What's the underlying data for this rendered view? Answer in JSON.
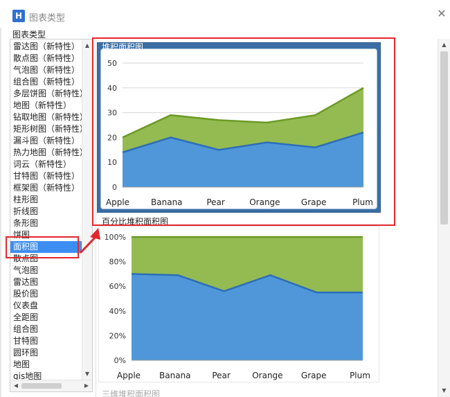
{
  "window": {
    "icon_letter": "H",
    "title": "图表类型",
    "close": "✕"
  },
  "section_label": "图表类型",
  "chart_types": [
    "雷达图（新特性）",
    "散点图（新特性）",
    "气泡图（新特性）",
    "组合图（新特性）",
    "多层饼图（新特性）",
    "地图（新特性）",
    "钻取地图（新特性）",
    "矩形树图（新特性）",
    "漏斗图（新特性）",
    "热力地图（新特性）",
    "词云（新特性）",
    "甘特图（新特性）",
    "框架图（新特性）",
    "柱形图",
    "折线图",
    "条形图",
    "饼图",
    "面积图",
    "散点图",
    "气泡图",
    "雷达图",
    "股价图",
    "仪表盘",
    "全距图",
    "组合图",
    "甘特图",
    "圆环图",
    "地图",
    "gis地图"
  ],
  "selected_index": 17,
  "previews": {
    "stacked_title": "堆积面积图",
    "percent_title": "百分比堆积面积图",
    "third_title": "三维堆积面积图"
  },
  "colors": {
    "blue_fill": "#4f97d9",
    "blue_line": "#2d6db8",
    "green_fill": "#93bb52",
    "green_line": "#6b9a24",
    "annotation": "#e3262b"
  },
  "chart_data": [
    {
      "type": "area",
      "stacked": true,
      "title": "堆积面积图",
      "categories": [
        "Apple",
        "Banana",
        "Pear",
        "Orange",
        "Grape",
        "Plum"
      ],
      "series": [
        {
          "values": [
            14,
            20,
            15,
            18,
            16,
            22
          ]
        },
        {
          "values": [
            6,
            9,
            12,
            8,
            13,
            18
          ]
        }
      ],
      "ylim": [
        0,
        50
      ],
      "yticks": [
        "0",
        "10",
        "20",
        "30",
        "40",
        "50"
      ],
      "grid": true
    },
    {
      "type": "area",
      "stacked": true,
      "percent": true,
      "title": "百分比堆积面积图",
      "categories": [
        "Apple",
        "Banana",
        "Pear",
        "Orange",
        "Grape",
        "Plum"
      ],
      "series": [
        {
          "values": [
            70,
            69,
            56,
            69,
            55,
            55
          ]
        },
        {
          "values": [
            30,
            31,
            44,
            31,
            45,
            45
          ]
        }
      ],
      "ylim": [
        0,
        100
      ],
      "yticks": [
        "0%",
        "20%",
        "40%",
        "60%",
        "80%",
        "100%"
      ],
      "grid": true
    }
  ]
}
